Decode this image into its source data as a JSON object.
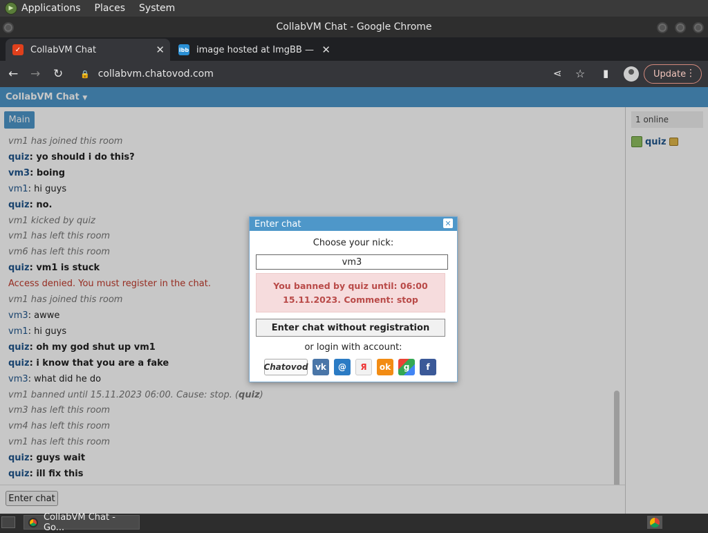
{
  "desktop": {
    "menus": [
      "Applications",
      "Places",
      "System"
    ]
  },
  "window": {
    "title": "CollabVM Chat - Google Chrome"
  },
  "browser": {
    "tabs": [
      {
        "title": "CollabVM Chat",
        "favicon": "chatovod-icon",
        "active": true
      },
      {
        "title": "image hosted at ImgBB — Img",
        "favicon": "ibb-icon",
        "active": false
      }
    ],
    "url": "collabvm.chatovod.com",
    "update_label": "Update"
  },
  "app": {
    "title": "CollabVM Chat",
    "room_tab": "Main",
    "enter_button": "Enter chat"
  },
  "messages": [
    {
      "type": "sys",
      "text": "vm1 has joined this room"
    },
    {
      "type": "msg",
      "nick": "quiz",
      "text": "yo should i do this?",
      "bold": true
    },
    {
      "type": "msg",
      "nick": "vm3",
      "text": "boing",
      "bold": true
    },
    {
      "type": "msg",
      "nick": "vm1",
      "text": "hi guys",
      "bold": false
    },
    {
      "type": "msg",
      "nick": "quiz",
      "text": "no.",
      "bold": true
    },
    {
      "type": "sys",
      "text": "vm1 kicked by quiz"
    },
    {
      "type": "sys",
      "text": "vm1 has left this room"
    },
    {
      "type": "sys",
      "text": "vm6 has left this room"
    },
    {
      "type": "msg",
      "nick": "quiz",
      "text": "vm1 is stuck",
      "bold": true
    },
    {
      "type": "err",
      "text": "Access denied. You must register in the chat."
    },
    {
      "type": "sys",
      "text": "vm1 has joined this room"
    },
    {
      "type": "msg",
      "nick": "vm3",
      "text": "awwe",
      "bold": false
    },
    {
      "type": "msg",
      "nick": "vm1",
      "text": "hi guys",
      "bold": false
    },
    {
      "type": "msg",
      "nick": "quiz",
      "text": "oh my god shut up vm1",
      "bold": true
    },
    {
      "type": "msg",
      "nick": "quiz",
      "text": "i know that you are a fake",
      "bold": true
    },
    {
      "type": "msg",
      "nick": "vm3",
      "text": "what did he do",
      "bold": false
    },
    {
      "type": "sys",
      "text": "vm1 banned until 15.11.2023 06:00. Cause: stop. (",
      "by": "quiz",
      "tail": ")"
    },
    {
      "type": "sys",
      "text": "vm3 has left this room"
    },
    {
      "type": "sys",
      "text": "vm4 has left this room"
    },
    {
      "type": "sys",
      "text": "vm1 has left this room"
    },
    {
      "type": "msg",
      "nick": "quiz",
      "text": "guys wait",
      "bold": true
    },
    {
      "type": "msg",
      "nick": "quiz",
      "text": "ill fix this",
      "bold": true
    }
  ],
  "users": {
    "count_label": "1 online",
    "list": [
      {
        "nick": "quiz"
      }
    ]
  },
  "dialog": {
    "title": "Enter chat",
    "prompt": "Choose your nick:",
    "nick_value": "vm3",
    "ban_message": "You banned by quiz until: 06:00 15.11.2023. Comment: stop",
    "noreg_button": "Enter chat without registration",
    "or_login": "or login with account:",
    "providers": [
      {
        "name": "chatovod",
        "label": "Chatovod",
        "color": "#fafafa"
      },
      {
        "name": "vk",
        "label": "vk",
        "color": "#4a76a8"
      },
      {
        "name": "mailru",
        "label": "@",
        "color": "#2b7bc4"
      },
      {
        "name": "yandex",
        "label": "Я",
        "color": "#f2f2f2"
      },
      {
        "name": "odnoklassniki",
        "label": "ok",
        "color": "#f28c14"
      },
      {
        "name": "google",
        "label": "g",
        "color": "#34a853"
      },
      {
        "name": "facebook",
        "label": "f",
        "color": "#3b5998"
      }
    ]
  },
  "taskbar": {
    "task_label": "CollabVM Chat - Go..."
  }
}
